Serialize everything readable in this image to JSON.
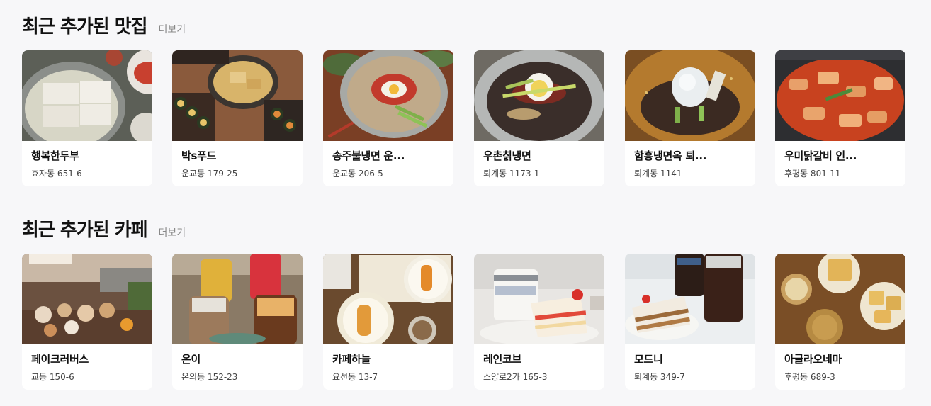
{
  "restaurants": {
    "title": "최근 추가된 맛집",
    "more": "더보기",
    "items": [
      {
        "name": "행복한두부",
        "address": "효자동 651-6",
        "photo": "tofu-stew-photo"
      },
      {
        "name": "박s푸드",
        "address": "운교동 179-25",
        "photo": "gimbap-tteokbokki-photo"
      },
      {
        "name": "송주불냉면 운...",
        "address": "운교동 206-5",
        "photo": "spicy-cold-noodles-photo"
      },
      {
        "name": "우촌칡냉면",
        "address": "퇴계동 1173-1",
        "photo": "arrowroot-cold-noodles-photo"
      },
      {
        "name": "함흥냉면옥 퇴...",
        "address": "퇴계동 1141",
        "photo": "hamhung-noodles-photo"
      },
      {
        "name": "우미닭갈비 인...",
        "address": "후평동 801-11",
        "photo": "dakgalbi-photo"
      }
    ]
  },
  "cafes": {
    "title": "최근 추가된 카페",
    "more": "더보기",
    "items": [
      {
        "name": "페이크러버스",
        "address": "교동 150-6",
        "photo": "dessert-display-photo"
      },
      {
        "name": "온이",
        "address": "온의동 152-23",
        "photo": "iced-drinks-photo"
      },
      {
        "name": "카페하늘",
        "address": "요선동 13-7",
        "photo": "toast-plates-photo"
      },
      {
        "name": "레인코브",
        "address": "소양로2가 165-3",
        "photo": "strawberry-cake-photo"
      },
      {
        "name": "모드니",
        "address": "퇴계동 349-7",
        "photo": "carrot-cake-coffee-photo"
      },
      {
        "name": "아글라오네마",
        "address": "후평동 689-3",
        "photo": "honey-bread-photo"
      }
    ]
  }
}
